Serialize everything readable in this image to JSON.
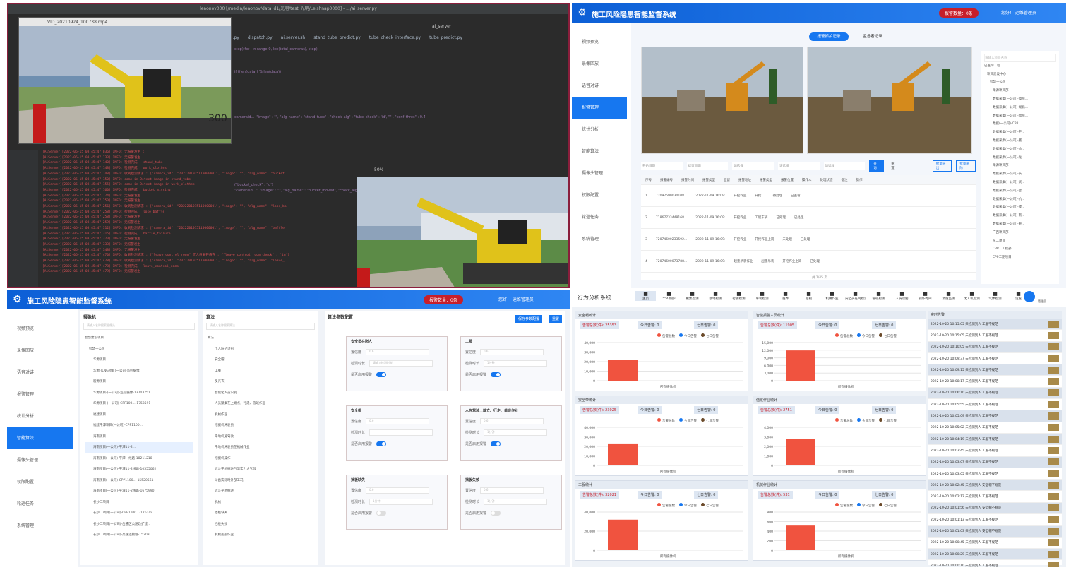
{
  "ide": {
    "title": "leaonov000 [/media/leaonov/data_d1/光明/test_光明/Leishnap0000] - .../ai_server.py",
    "video1_title": "VID_20210924_100738.mp4",
    "video2_zoom": "50%",
    "tabs": [
      "fig.py",
      "dispatch.py",
      "ai.server.sh",
      "stand_tube_predict.py",
      "tube_check_interface.py",
      "tube_predict.py"
    ],
    "toolbar": "ai_server",
    "code": "step) for i in range(0, len(total_cameras), step)\n\n\n\nif ((len(data)) % len(data))\n\n\n\n\n\n\n\ncameraid...  \"image\" : \"\", \"alg_name\" : \"stand_tube\" , \"check_alg\" : \"tube_check\" : 'id', \"\" , \"conf_thres\" : 0.4\n\n\n\n\n\n\n\n\n\n\n\n(\"bucket_check\" : 'id')\n\"cameraid...\", \"image\" : \"\", \"alg_name\" : \"bucket_moved\", \"check_alg\" : (\"bucket_check\" : 'id'), \"conf_thres\" : 0.4)",
    "log": [
      "[AiServer][2022-06-15 08:45:47,036] INFO: 无报警发生 :",
      "[AiServer][2022-06-15 08:45:47,133] INFO: 无报警发生",
      "[AiServer][2022-06-15 08:45:47,140] INFO: 检测完成 : stand_tube",
      "[AiServer][2022-06-15 08:45:47,148] INFO: 检测完成 : work_clothes",
      "[AiServer][2022-06-15 08:45:47,148] INFO: 收到检测请求 : {\"camera_id\": \"2022201015110000001\", \"image\": \"\", \"alg_name\": \"bucket",
      "[AiServer][2022-06-15 08:45:47,150] INFO: come in Detect image in stand_tube",
      "[AiServer][2022-06-15 08:45:47,155] INFO: come in Detect image in work_clothes",
      "[AiServer][2022-06-15 08:45:47,160] INFO: 检测完成 : bucket_missing",
      "[AiServer][2022-06-15 08:45:47,174] INFO: 无报警发生",
      "[AiServer][2022-06-15 08:45:47,250] INFO: 无报警发生",
      "[AiServer][2022-06-15 08:45:47,256] INFO: 收到检测请求 : {\"camera_id\": \"2022201015110000001\", \"image\": \"\", \"alg_name\": \"lose_ba",
      "[AiServer][2022-06-15 08:45:47,258] INFO: 检测完成 : lose_baffle",
      "[AiServer][2022-06-15 08:45:47,258] INFO: 无报警发生",
      "[AiServer][2022-06-15 08:45:47,259] INFO: 无报警发生",
      "[AiServer][2022-06-15 08:45:47,312] INFO: 收到检测请求 : {\"camera_id\": \"2022201015110000001\", \"image\": \"\", \"alg_name\": \"baffle",
      "[AiServer][2022-06-15 08:45:47,315] INFO: 检测完成 : baffle_failure",
      "[AiServer][2022-06-15 08:45:47,320] INFO: 无报警发生",
      "[AiServer][2022-06-15 08:45:47,333] INFO: 无报警发生",
      "[AiServer][2022-06-15 08:45:47,348] INFO: 无报警发生",
      "[AiServer][2022-06-15 08:45:47,470] INFO: 收到检测请求 : {\"leave_control_room\" 无人员离开值守 : {\"leave_control_room_check\" : 'in'}",
      "[AiServer][2022-06-15 08:45:47,478] INFO: 收到检测请求 : {\"camera_id\": \"2022201015110000001\", \"image\": \"\", \"alg_name\": \"leave_",
      "[AiServer][2022-06-15 08:45:47,478] INFO: 检测完成 : leave_control_room",
      "[AiServer][2022-06-15 08:45:47,479] INFO: 无报警发生"
    ]
  },
  "app": {
    "title": "施工风险隐患智能监督系统",
    "alarm": "报警数量：0条",
    "user": "您好！ 运维管理员",
    "menu_tr": [
      "视频预览",
      "录像回放",
      "语音对讲",
      "报警管理",
      "统计分析",
      "智能算法",
      "摄像头管理",
      "权限配置",
      "轮巡任务",
      "系统管理"
    ],
    "menu_bl": [
      "视频预览",
      "录像回放",
      "语音对讲",
      "报警管理",
      "统计分析",
      "智能算法",
      "摄像头管理",
      "权限配置",
      "轮巡任务",
      "系统管理"
    ]
  },
  "monitor": {
    "tabs": [
      "报警抓拍记录",
      "监督者记录"
    ],
    "filters": [
      "开始日期",
      "结束日期",
      "请选择",
      "请选择",
      "请选择"
    ],
    "buttons": [
      "查询",
      "重置",
      "批量导出",
      "批量删除"
    ],
    "cols": [
      "序号",
      "报警编号",
      "报警时间",
      "报警类型",
      "监督",
      "报警地址",
      "报警类型",
      "报警位置",
      "操作人",
      "处理状态",
      "备注",
      "操作"
    ],
    "rows": [
      [
        "1",
        "72097590030108...",
        "2022-11-09 16:09:",
        "开挖作业",
        "开挖...",
        "待处理",
        "已查看"
      ],
      [
        "2",
        "71867733448168...",
        "2022-11-09 16:09:",
        "开挖作业",
        "工程车辆",
        "已处理",
        "已处理"
      ],
      [
        "3",
        "72074600233592...",
        "2022-11-09 16:09:",
        "开挖作业",
        "开挖作业上岗",
        "未处理",
        "已处理"
      ],
      [
        "4",
        "72074600073788...",
        "2022-11-09 16:09:",
        "起重吊装作业",
        "起重吊装",
        "开挖作业上岗",
        "已处理"
      ]
    ],
    "pager": "共 1/45 页",
    "tree_search": "请输入项目名称",
    "tree": [
      "已查询工程",
      "项目建设中心",
      "智慧一公司",
      "华源项目部",
      "数据采集(一公司)-漳州...",
      "数据采集(一公司)-湖北...",
      "数据采集(一公司)-福州...",
      "数据(一公司)-CPP...",
      "数据采集(一公司)-宁...",
      "数据采集(一公司)-厦...",
      "数据采集(一公司)-汕...",
      "数据采集(一公司)-龙...",
      "华源项目部",
      "数据采集(一公司)-长...",
      "数据采集(一公司)-武...",
      "数据采集(一公司)-合...",
      "数据采集(一公司)-杭...",
      "数据采集(一公司)-成...",
      "数据采集(一公司)-南...",
      "数据采集(一公司)-重...",
      "广西项目部",
      "东二项目",
      "CPP二工程部",
      "CPP二期项目"
    ]
  },
  "algo": {
    "col1_title": "摄像机",
    "col2_title": "算法",
    "col3_title": "算法参数配置",
    "btn_save": "保存参数配置",
    "btn_reset": "重置",
    "search1": "请输入名称搜索摄像头",
    "search2": "请输入名称搜索算法",
    "cams": [
      "智慧建设项目",
      "智慧一公司",
      "华源项目",
      "华源-(LNG项目)一公司-监控摄像",
      "宏源项目",
      "华源项目-(一公司)-监控摄像-13703751",
      "华源项目-(一公司)-CPP100...-1753591",
      "福建项目",
      "福建平潭项目(一公司)-CPP1100...",
      "海南项目",
      "海南项目(一公司)-平潭11-2...",
      "海南项目(一公司)-平潭一线路-18211218",
      "海南项目(一公司)-平潭11-2线路-10555062",
      "海南项目(一公司)-CPP1100...-15520561",
      "海南项目(一公司)-平潭11-2线路-1675990",
      "长沙二项目",
      "长沙二项目(一公司)-CPP1100...-176149",
      "长沙二项目(一公司)-岳麓区公路改扩建...",
      "长沙二项目(一公司)-高速连接线-15203..."
    ],
    "algos": [
      "算法",
      "个人防护识别",
      "安全帽",
      "工服",
      "反光衣",
      "智能化人员识别",
      "人员聚集在上端点，行走、值班作业",
      "机械作业",
      "挖掘机驾驶员",
      "平地机施驾驶",
      "平地机驾驶员在机械作业",
      "挖掘机操作",
      "铲斗平地掘进气温实力大气温",
      "斗齿实际时外部工况",
      "铲斗平地掘进",
      "机械",
      "挡板缺失",
      "挡板失效",
      "机械违规作业"
    ],
    "cards": [
      {
        "title": "安全员在岗人",
        "t1": "置信度",
        "v1": "0.6",
        "t2": "检测时长",
        "v2": "请输入检测时长",
        "t3": "是否启用报警",
        "on": true
      },
      {
        "title": "工服",
        "t1": "置信度",
        "v1": "0.6",
        "t2": "检测时长",
        "v2": "1分钟",
        "t3": "是否启用报警",
        "on": true
      },
      {
        "title": "安全帽",
        "t1": "置信度",
        "v1": "0.6",
        "t2": "检测时长",
        "v2": "",
        "t3": "是否启用报警",
        "on": true
      },
      {
        "title": "人在驾驶上端立、行走、值班作业",
        "t1": "置信度",
        "v1": "0.6",
        "t2": "检测时长",
        "v2": "1分钟",
        "t3": "是否启用报警",
        "on": true
      },
      {
        "title": "挡板缺失",
        "t1": "置信度",
        "v1": "0.6",
        "t2": "检测时长",
        "v2": "1分钟",
        "t3": "是否启用报警",
        "on": false
      },
      {
        "title": "挡板失效",
        "t1": "置信度",
        "v1": "0.6",
        "t2": "检测时长",
        "v2": "1分钟",
        "t3": "是否启用报警",
        "on": false
      }
    ]
  },
  "behavior": {
    "title": "行为分析系统",
    "nav": [
      "主页",
      "个人防护",
      "聚集检测",
      "接地检测",
      "行驶检测",
      "吊装检测",
      "越界",
      "巡视",
      "机械作业",
      "安全员在岗检测",
      "值班检测",
      "人员识别",
      "操作时间",
      "消防监测",
      "无人机检测",
      "气体检测",
      "设置"
    ],
    "user": "管理员",
    "stats": [
      {
        "title": "安全帽统计",
        "total": "告警总数(件): 25353",
        "today": "今日告警: 0",
        "week": "七日告警: 0",
        "bar": "所有摄像机"
      },
      {
        "title": "智能报警人员统计",
        "total": "告警总数(件): 11905",
        "today": "今日告警: 0",
        "week": "七日告警: 0",
        "bar": "所有摄像机"
      },
      {
        "title": "安全带统计",
        "total": "告警总数(件): 23025",
        "today": "今日告警: 0",
        "week": "七日告警: 0",
        "bar": "所有摄像机"
      },
      {
        "title": "值班作业统计",
        "total": "告警总数(件): 2751",
        "today": "今日告警: 0",
        "week": "七日告警: 0",
        "bar": "所有摄像机"
      },
      {
        "title": "工服统计",
        "total": "告警总数(件): 32021",
        "today": "今日告警: 0",
        "week": "七日告警: 0",
        "bar": "所有摄像机"
      },
      {
        "title": "机械作业统计",
        "total": "告警总数(件): 531",
        "today": "今日告警: 0",
        "week": "七日告警: 0",
        "bar": "所有摄像机"
      }
    ],
    "legend": [
      "告警总数",
      "今日告警",
      "七日告警"
    ],
    "records_title": "实时告警",
    "records": [
      "2022-10-20 10:15:05 未检测到人 工服不规范",
      "2022-10-20 10:15:05 未检测到人 工服不规范",
      "2022-10-20 10:10:05 未检测到人 工服不规范",
      "2022-10-20 10:09:37 未检测到人 工服不规范",
      "2022-10-20 10:09:15 未检测到人 工服不规范",
      "2022-10-20 10:08:17 未检测到人 工服不规范",
      "2022-10-20 10:06:10 未检测到人 工服不规范",
      "2022-10-20 10:05:55 未检测到人 工服不规范",
      "2022-10-20 10:05:09 未检测到人 工服不规范",
      "2022-10-20 10:05:02 未检测到人 工服不规范",
      "2022-10-20 10:04:19 未检测到人 工服不规范",
      "2022-10-20 10:03:45 未检测到人 工服不规范",
      "2022-10-20 10:03:07 未检测到人 工服不规范",
      "2022-10-20 10:03:05 未检测到人 工服不规范",
      "2022-10-20 10:02:45 未检测到人 安全帽不规范",
      "2022-10-20 10:02:12 未检测到人 工服不规范",
      "2022-10-20 10:01:56 未检测到人 安全帽不规范",
      "2022-10-20 10:01:13 未检测到人 工服不规范",
      "2022-10-20 10:01:03 未检测到人 安全帽不规范",
      "2022-10-20 10:00:45 未检测到人 工服不规范",
      "2022-10-20 10:00:29 未检测到人 工服不规范",
      "2022-10-20 10:00:10 未检测到人 工服不规范"
    ]
  },
  "chart_data": [
    {
      "type": "bar",
      "title": "安全帽统计",
      "categories": [
        "所有摄像机"
      ],
      "values": [
        22000
      ],
      "ylim": [
        0,
        40000
      ],
      "yticks": [
        "40,000",
        "30,000",
        "20,000",
        "10,000",
        "0"
      ]
    },
    {
      "type": "bar",
      "title": "智能报警人员统计",
      "categories": [
        "所有摄像机"
      ],
      "values": [
        11905
      ],
      "ylim": [
        0,
        15000
      ],
      "yticks": [
        "15,000",
        "12,000",
        "9,000",
        "6,000",
        "3,000",
        "0"
      ]
    },
    {
      "type": "bar",
      "title": "安全带统计",
      "categories": [
        "所有摄像机"
      ],
      "values": [
        23025
      ],
      "ylim": [
        0,
        40000
      ],
      "yticks": [
        "40,000",
        "30,000",
        "20,000",
        "10,000",
        "0"
      ]
    },
    {
      "type": "bar",
      "title": "值班作业统计",
      "categories": [
        "所有摄像机"
      ],
      "values": [
        2751
      ],
      "ylim": [
        0,
        4000
      ],
      "yticks": [
        "4,000",
        "3,000",
        "2,000",
        "1,000",
        "0"
      ]
    },
    {
      "type": "bar",
      "title": "工服统计",
      "categories": [
        "所有摄像机"
      ],
      "values": [
        32021
      ],
      "ylim": [
        0,
        40000
      ],
      "yticks": [
        "40,000",
        "20,000",
        "0"
      ]
    },
    {
      "type": "bar",
      "title": "机械作业统计",
      "categories": [
        "所有摄像机"
      ],
      "values": [
        531
      ],
      "ylim": [
        0,
        800
      ],
      "yticks": [
        "800",
        "600",
        "400",
        "200",
        "0"
      ]
    }
  ]
}
